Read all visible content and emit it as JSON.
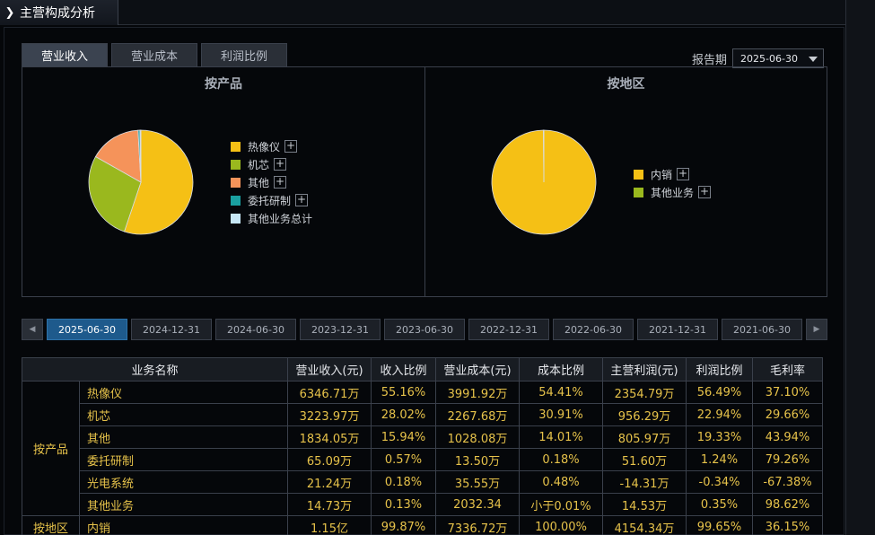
{
  "title": "主营构成分析",
  "tabs": [
    "营业收入",
    "营业成本",
    "利润比例"
  ],
  "report": {
    "label": "报告期",
    "value": "2025-06-30"
  },
  "charts": {
    "product": {
      "title": "按产品",
      "legend": [
        {
          "label": "热像仪",
          "color": "#f5c015",
          "expand": "+"
        },
        {
          "label": "机芯",
          "color": "#9ab81e",
          "expand": "+"
        },
        {
          "label": "其他",
          "color": "#f5935a",
          "expand": "+"
        },
        {
          "label": "委托研制",
          "color": "#1aa0a0",
          "expand": "+"
        },
        {
          "label": "其他业务总计",
          "color": "#c6e6f5",
          "expand": ""
        }
      ]
    },
    "region": {
      "title": "按地区",
      "legend": [
        {
          "label": "内销",
          "color": "#f5c015",
          "expand": "+"
        },
        {
          "label": "其他业务",
          "color": "#9ab81e",
          "expand": "+"
        }
      ]
    }
  },
  "chart_data": [
    {
      "type": "pie",
      "categories": [
        "热像仪",
        "机芯",
        "其他",
        "委托研制",
        "光电系统",
        "其他业务"
      ],
      "values": [
        55.16,
        28.02,
        15.94,
        0.57,
        0.18,
        0.13
      ]
    },
    {
      "type": "pie",
      "categories": [
        "内销",
        "其他业务"
      ],
      "values": [
        99.87,
        0.13
      ]
    }
  ],
  "dates": [
    "2025-06-30",
    "2024-12-31",
    "2024-06-30",
    "2023-12-31",
    "2023-06-30",
    "2022-12-31",
    "2022-06-30",
    "2021-12-31",
    "2021-06-30"
  ],
  "nav": {
    "prev": "◀",
    "next": "▶"
  },
  "table": {
    "headers": [
      "业务名称",
      "营业收入(元)",
      "收入比例",
      "营业成本(元)",
      "成本比例",
      "主营利润(元)",
      "利润比例",
      "毛利率"
    ],
    "groups": [
      "按产品",
      "按地区"
    ],
    "rows": [
      [
        "热像仪",
        "6346.71万",
        "55.16%",
        "3991.92万",
        "54.41%",
        "2354.79万",
        "56.49%",
        "37.10%"
      ],
      [
        "机芯",
        "3223.97万",
        "28.02%",
        "2267.68万",
        "30.91%",
        "956.29万",
        "22.94%",
        "29.66%"
      ],
      [
        "其他",
        "1834.05万",
        "15.94%",
        "1028.08万",
        "14.01%",
        "805.97万",
        "19.33%",
        "43.94%"
      ],
      [
        "委托研制",
        "65.09万",
        "0.57%",
        "13.50万",
        "0.18%",
        "51.60万",
        "1.24%",
        "79.26%"
      ],
      [
        "光电系统",
        "21.24万",
        "0.18%",
        "35.55万",
        "0.48%",
        "-14.31万",
        "-0.34%",
        "-67.38%"
      ],
      [
        "其他业务",
        "14.73万",
        "0.13%",
        "2032.34",
        "小于0.01%",
        "14.53万",
        "0.35%",
        "98.62%"
      ],
      [
        "内销",
        "1.15亿",
        "99.87%",
        "7336.72万",
        "100.00%",
        "4154.34万",
        "99.65%",
        "36.15%"
      ]
    ]
  }
}
